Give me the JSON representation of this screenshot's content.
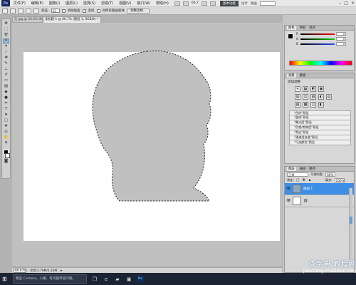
{
  "app": {
    "logo": "Ps"
  },
  "menu": [
    "文件(F)",
    "编辑(E)",
    "图像(I)",
    "图层(L)",
    "选择(S)",
    "滤镜(T)",
    "视图(V)",
    "窗口(W)",
    "帮助(H)"
  ],
  "titlebar": {
    "zoom_label": "66.7",
    "workspace_button": "基本功能",
    "link_a": "设计",
    "link_b": "绘画"
  },
  "options": {
    "feather_label": "容差:",
    "feather_value": "32",
    "antialias_label": "消除锯齿",
    "contiguous_label": "连续",
    "sample_all_label": "对所有图层取样",
    "refine_edge_button": "调整边缘..."
  },
  "document": {
    "inactive_tab": "元.jpg @ 33.3% (RGB/8#)",
    "active_tab": "未标题-1 @ 66.7% (图层 1, RGB/8) *",
    "zoom": "66.67%",
    "size": "文档:2.79M/3.33M"
  },
  "color_panel": {
    "tabs": [
      "颜色",
      "色板",
      "样式"
    ],
    "channels": [
      {
        "label": "R",
        "value": "0",
        "color": "#ff0000"
      },
      {
        "label": "G",
        "value": "0",
        "color": "#00cc00"
      },
      {
        "label": "B",
        "value": "0",
        "color": "#2a4dff"
      }
    ]
  },
  "adjustments_panel": {
    "tabs": [
      "调整",
      "蒙版"
    ],
    "title": "添加调整",
    "icon_row_1": [
      "☀",
      "▦",
      "◩",
      "▣"
    ],
    "icon_row_2": [
      "▥",
      "⚖",
      "▧",
      "◐",
      "▤"
    ],
    "icon_row_3": [
      "▨",
      "▩",
      "◫",
      "◧"
    ],
    "presets": [
      "\"色阶\"预设",
      "\"曲线\"预设",
      "\"曝光度\"预设",
      "\"色相/饱和度\"预设",
      "\"黑白\"预设",
      "\"通道混合器\"预设",
      "\"可选颜色\"预设"
    ]
  },
  "layers_panel": {
    "tabs": [
      "图层",
      "通道",
      "路径"
    ],
    "blend_mode": "正常",
    "opacity_label": "不透明度:",
    "opacity_value": "80%",
    "lock_label": "锁定:",
    "fill_label": "填充:",
    "fill_value": "100%",
    "layers": [
      {
        "name": "图层 1",
        "selected": true
      },
      {
        "name": "",
        "selected": false
      }
    ]
  },
  "taskbar": {
    "search_placeholder": "我是 Cortana，小娜。有问题尽管问我。"
  },
  "watermark": {
    "line1": "查字典 教程网",
    "line2": "jiaocheng.chazidian.com"
  }
}
